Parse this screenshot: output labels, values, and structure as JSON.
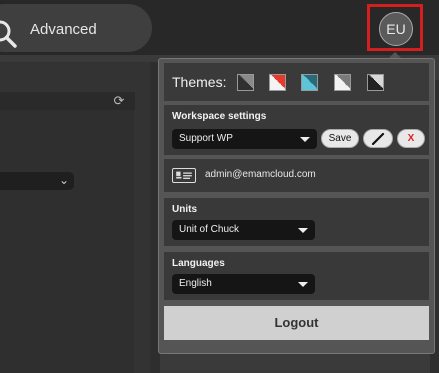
{
  "header": {
    "search_label": "Advanced",
    "avatar_initials": "EU"
  },
  "user_menu": {
    "themes_label": "Themes:",
    "theme_swatches": [
      {
        "name": "dark",
        "colors": [
          "#303030",
          "#8a8a8a"
        ]
      },
      {
        "name": "red",
        "colors": [
          "#f4f4f4",
          "#e83a2a"
        ]
      },
      {
        "name": "teal",
        "colors": [
          "#5fc4d8",
          "#2a6b7a"
        ]
      },
      {
        "name": "light",
        "colors": [
          "#f2f2f2",
          "#7a7a7a"
        ]
      },
      {
        "name": "black",
        "colors": [
          "#222222",
          "#d8d8d8"
        ]
      }
    ],
    "workspace": {
      "title": "Workspace settings",
      "selected": "Support WP",
      "save_label": "Save",
      "edit_icon": "pencil-icon",
      "delete_label": "X"
    },
    "email": "admin@emamcloud.com",
    "units": {
      "title": "Units",
      "selected": "Unit of Chuck"
    },
    "languages": {
      "title": "Languages",
      "selected": "English"
    },
    "logout_label": "Logout"
  },
  "colors": {
    "highlight_border": "#d41f1f",
    "delete_red": "#e02020"
  }
}
